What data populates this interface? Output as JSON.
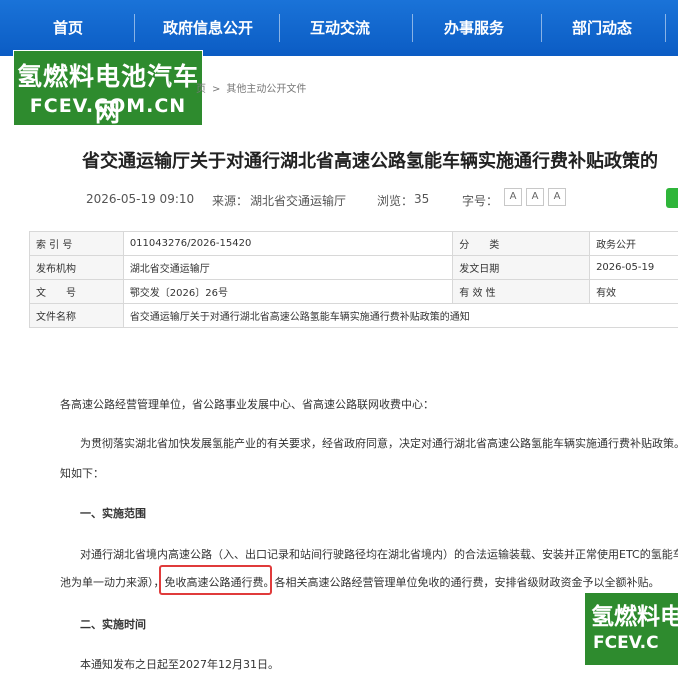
{
  "nav": {
    "items": [
      "首页",
      "政府信息公开",
      "互动交流",
      "办事服务",
      "部门动态"
    ]
  },
  "logo": {
    "cn": "氢燃料电池汽车网",
    "en": "FCEV.COM.CN"
  },
  "breadcrumb": {
    "item1": "页",
    "item2": "其他主动公开文件"
  },
  "article": {
    "title": "省交通运输厅关于对通行湖北省高速公路氢能车辆实施通行费补贴政策的",
    "datetime": "2026-05-19 09:10",
    "source_label": "来源：",
    "source_value": "湖北省交通运输厅",
    "views_label": "浏览：",
    "views_value": "35",
    "fontsize_label": "字号：",
    "fontsize_buttons": [
      "A",
      "A",
      "A"
    ]
  },
  "info_table": {
    "index_label": "索 引 号",
    "index_value": "011043276/2026-15420",
    "category_label": "分　　类",
    "category_value": "政务公开",
    "publisher_label": "发布机构",
    "publisher_value": "湖北省交通运输厅",
    "date_label": "发文日期",
    "date_value": "2026-05-19",
    "docno_label": "文　　号",
    "docno_value": "鄂交发〔2026〕26号",
    "validity_label": "有 效 性",
    "validity_value": "有效",
    "name_label": "文件名称",
    "name_value": "省交通运输厅关于对通行湖北省高速公路氢能车辆实施通行费补贴政策的通知"
  },
  "body": {
    "p_recipients": "各高速公路经营管理单位，省公路事业发展中心、省高速公路联网收费中心：",
    "p_intro_1": "为贯彻落实湖北省加快发展氢能产业的有关要求，经省政府同意，决定对通行湖北省高速公路氢能车辆实施通行费补贴政策。现",
    "p_intro_2": "知如下：",
    "h_scope": "一、实施范围",
    "p_scope_1": "对通行湖北省境内高速公路（入、出口记录和站间行驶路径均在湖北省境内）的合法运输装载、安装并正常使用ETC的氢能车辆",
    "p_scope_2a": "池为单一动力来源），",
    "p_scope_2b": "免收高速公路通行费。",
    "p_scope_2c": "各相关高速公路经营管理单位免收的通行费，安排省级财政资金予以全额补贴。",
    "h_time": "二、实施时间",
    "p_time": "本通知发布之日起至2027年12月31日。"
  },
  "watermark": {
    "cn": "氢燃料电",
    "en": "FCEV.C"
  }
}
